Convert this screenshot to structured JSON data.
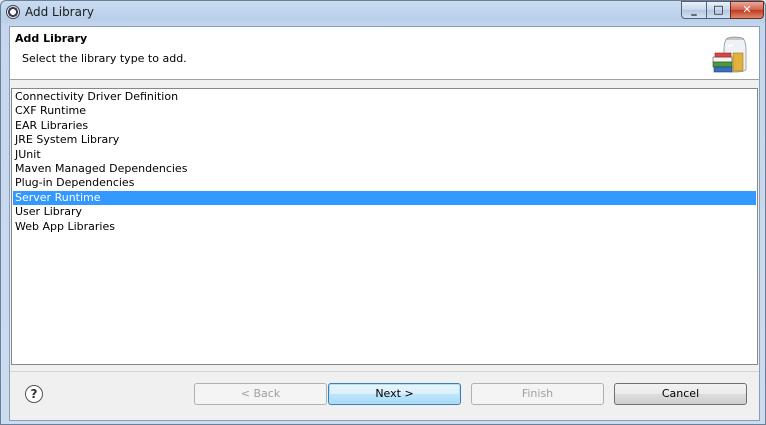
{
  "window": {
    "title": "Add Library",
    "controls": {
      "minimize": "_",
      "maximize": "□",
      "close": "✕"
    }
  },
  "banner": {
    "title": "Add Library",
    "description": "Select the library type to add.",
    "image_icon": "library-jar-books-icon"
  },
  "library_types": {
    "items": [
      "Connectivity Driver Definition",
      "CXF Runtime",
      "EAR Libraries",
      "JRE System Library",
      "JUnit",
      "Maven Managed Dependencies",
      "Plug-in Dependencies",
      "Server Runtime",
      "User Library",
      "Web App Libraries"
    ],
    "selected": "Server Runtime"
  },
  "buttons": {
    "help": "?",
    "back": "< Back",
    "next": "Next >",
    "finish": "Finish",
    "cancel": "Cancel"
  },
  "colors": {
    "selection": "#3399ff",
    "client_bg": "#f0f0f0",
    "frame": "#b9cfe9"
  }
}
